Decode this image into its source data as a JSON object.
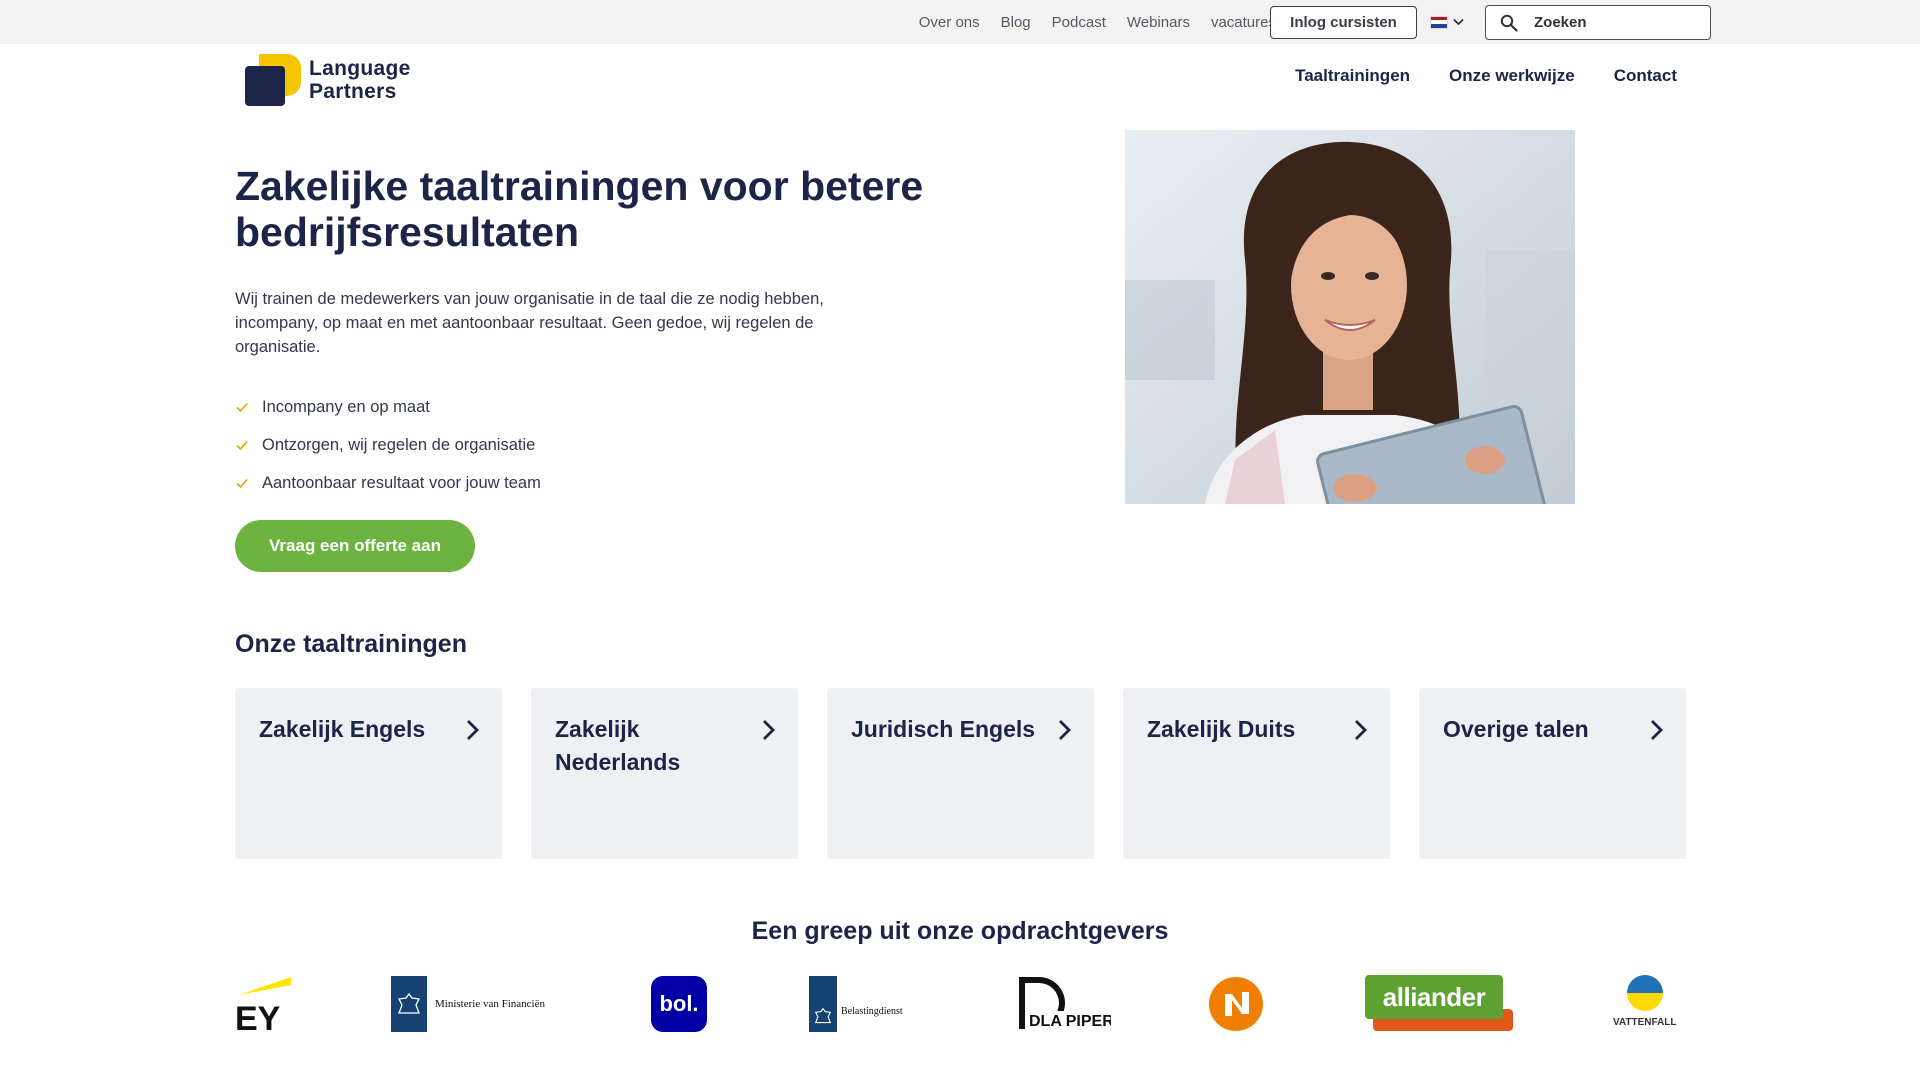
{
  "topbar": {
    "links": [
      "Over ons",
      "Blog",
      "Podcast",
      "Webinars",
      "vacatures"
    ],
    "login_label": "Inlog cursisten",
    "language_flag": "NL",
    "search_placeholder": "Zoeken"
  },
  "header": {
    "logo_line1": "Language",
    "logo_line2": "Partners",
    "nav": [
      "Taaltrainingen",
      "Onze werkwijze",
      "Contact"
    ]
  },
  "hero": {
    "title": "Zakelijke taaltrainingen voor betere bedrijfsresultaten",
    "intro": "Wij trainen de medewerkers van jouw organisatie in de taal die ze nodig hebben, incompany, op maat en met aantoonbaar resultaat. Geen gedoe, wij regelen de organisatie.",
    "checks": [
      "Incompany en op maat",
      "Ontzorgen, wij regelen de organisatie",
      "Aantoonbaar resultaat voor jouw team"
    ],
    "cta": "Vraag een offerte aan"
  },
  "trainings": {
    "title": "Onze taaltrainingen",
    "cards": [
      "Zakelijk Engels",
      "Zakelijk Nederlands",
      "Juridisch Engels",
      "Zakelijk Duits",
      "Overige talen"
    ]
  },
  "clients": {
    "title": "Een greep uit onze opdrachtgevers",
    "ey": "EY",
    "minfin": "Ministerie van Financiën",
    "bol": "bol.",
    "belasting": "Belastingdienst",
    "dla": "DLA PIPER",
    "alliander": "alliander",
    "vattenfall": "VATTENFALL"
  },
  "colors": {
    "navy": "#1c2447",
    "green": "#6cb33f",
    "yellow": "#f6c500",
    "card_bg": "#eff0f4"
  }
}
